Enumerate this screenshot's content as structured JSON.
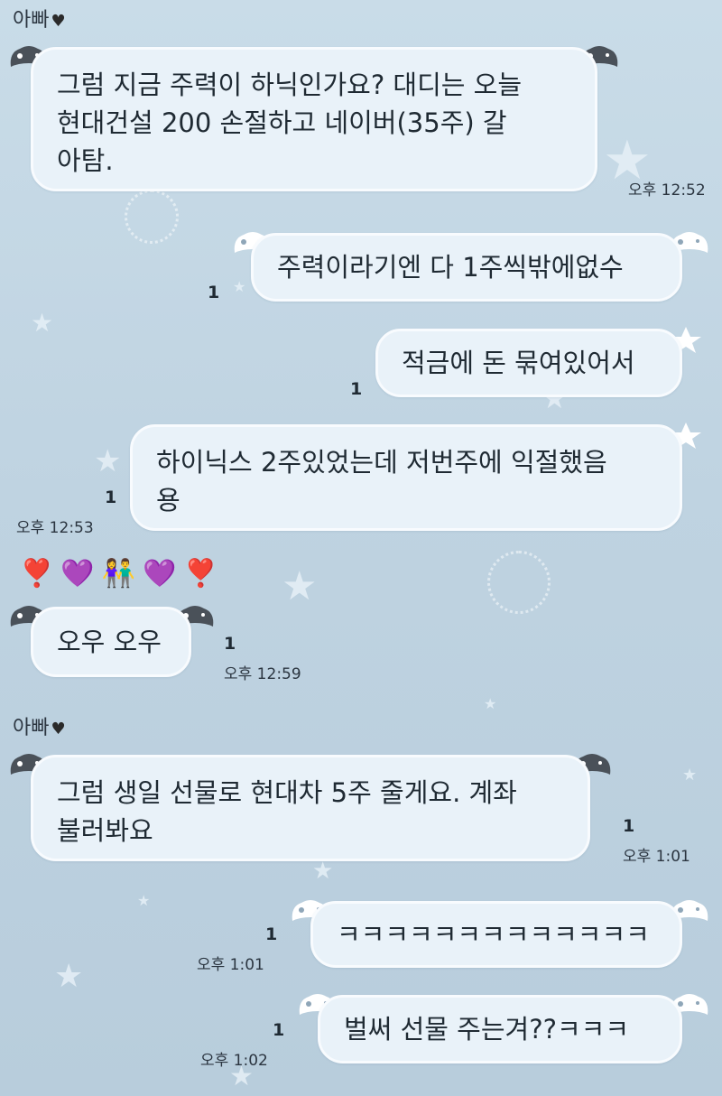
{
  "chat": {
    "sender_name": "아빠",
    "messages": [
      {
        "text_lines": [
          "그럼 지금 주력이 하닉인가요? 대디는 오늘",
          "현대건설 200 손절하고 네이버(35주) 갈",
          "아탐."
        ],
        "time": "오후 12:52"
      },
      {
        "text": "주력이라기엔 다 1주씩밖에없수",
        "unread": "1"
      },
      {
        "text": "적금에 돈 묶여있어서",
        "unread": "1"
      },
      {
        "text_lines": [
          "하이닉스 2주있었는데 저번주에 익절했음",
          "용"
        ],
        "unread": "1",
        "time": "오후 12:53"
      },
      {
        "emojis": [
          "❣️",
          "💜",
          "👫",
          "💜",
          "❣️"
        ]
      },
      {
        "text": "오우 오우",
        "unread": "1",
        "time": "오후 12:59"
      },
      {
        "text_lines": [
          "그럼 생일 선물로 현대차 5주 줄게요. 계좌",
          "불러봐요"
        ],
        "unread": "1",
        "time": "오후 1:01"
      },
      {
        "text": "ㅋㅋㅋㅋㅋㅋㅋㅋㅋㅋㅋㅋㅋ",
        "unread": "1",
        "time": "오후 1:01"
      },
      {
        "text": "벌써 선물 주는겨??ㅋㅋㅋ",
        "unread": "1",
        "time": "오후 1:02"
      }
    ]
  },
  "icons": {
    "heart": "black-heart-icon",
    "bubble_decor": "gamepad-ear-icon",
    "background": "star-icon"
  },
  "colors": {
    "background": "#c3d7e4",
    "bubble": "#e9f2f9",
    "ear_dark": "#4a5159",
    "ear_light": "#ffffff"
  }
}
